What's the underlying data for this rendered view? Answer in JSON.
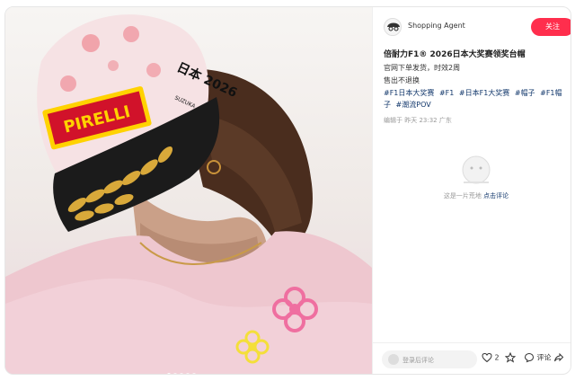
{
  "author": {
    "name": "Shopping Agent",
    "follow_label": "关注"
  },
  "post": {
    "title": "倍耐力F1® 2026日本大奖赛领奖台帽",
    "lines": [
      "官网下单发货，时效2周",
      "售出不退换"
    ],
    "tags": [
      "#F1日本大奖赛",
      "#F1",
      "#日本F1大奖赛",
      "#帽子",
      "#F1帽子",
      "#潮流POV"
    ],
    "meta": "编辑于 昨天 23:32 广东"
  },
  "image": {
    "cap_brand": "PIRELLI",
    "cap_text": "日本 2026",
    "cap_small": "SUZUKA"
  },
  "empty_state": {
    "text": "这是一片荒地",
    "link": "点击评论"
  },
  "bottom": {
    "comment_placeholder": "登录后评论",
    "like_count": "2",
    "comment_label": "评论"
  },
  "carousel": {
    "total": 5,
    "active": 0
  },
  "colors": {
    "accent": "#ff2e4d",
    "link": "#13386c"
  }
}
